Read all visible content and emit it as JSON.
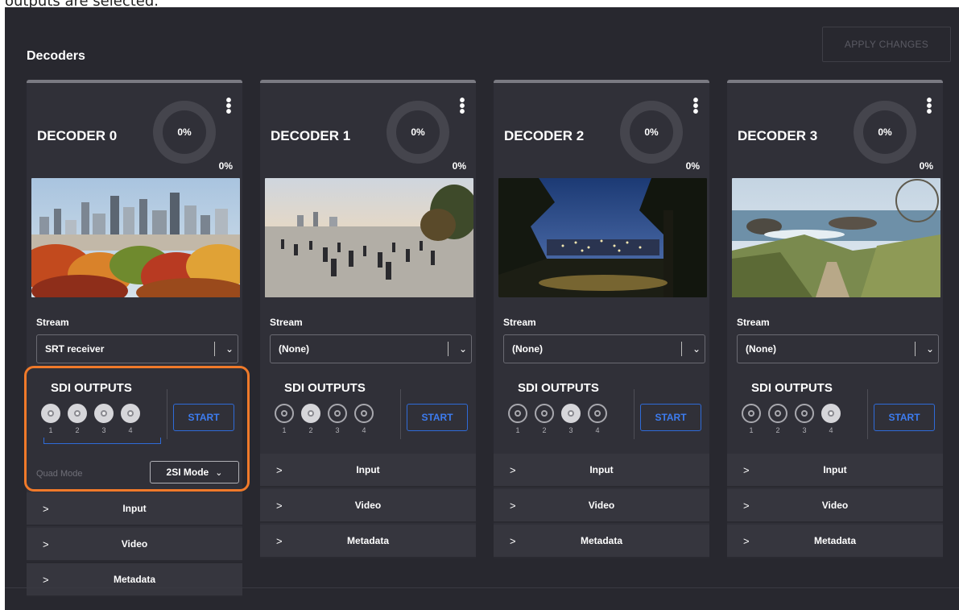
{
  "caption": "outputs are selected.",
  "header": {
    "title": "Decoders",
    "apply_label": "APPLY CHANGES"
  },
  "decoders": [
    {
      "title": "DECODER 0",
      "donut_pct": "0%",
      "pct": "0%",
      "image": "Montreal city skyline with autumn trees",
      "stream_label": "Stream",
      "stream_value": "SRT receiver",
      "sdi_label": "SDI OUTPUTS",
      "sdi_outputs": [
        {
          "num": "1",
          "on": true
        },
        {
          "num": "2",
          "on": true
        },
        {
          "num": "3",
          "on": true
        },
        {
          "num": "4",
          "on": true
        }
      ],
      "start_label": "START",
      "quad_label": "Quad Mode",
      "quad_value": "2SI Mode",
      "sections": [
        "Input",
        "Video",
        "Metadata"
      ]
    },
    {
      "title": "DECODER 1",
      "donut_pct": "0%",
      "pct": "0%",
      "image": "Crowded plaza at dusk overlooking city",
      "stream_label": "Stream",
      "stream_value": "(None)",
      "sdi_label": "SDI OUTPUTS",
      "sdi_outputs": [
        {
          "num": "1",
          "on": false
        },
        {
          "num": "2",
          "on": true
        },
        {
          "num": "3",
          "on": false
        },
        {
          "num": "4",
          "on": false
        }
      ],
      "start_label": "START",
      "sections": [
        "Input",
        "Video",
        "Metadata"
      ]
    },
    {
      "title": "DECODER 2",
      "donut_pct": "0%",
      "pct": "0%",
      "image": "City lights at night seen through trees",
      "stream_label": "Stream",
      "stream_value": "(None)",
      "sdi_label": "SDI OUTPUTS",
      "sdi_outputs": [
        {
          "num": "1",
          "on": false
        },
        {
          "num": "2",
          "on": false
        },
        {
          "num": "3",
          "on": true
        },
        {
          "num": "4",
          "on": false
        }
      ],
      "start_label": "START",
      "sections": [
        "Input",
        "Video",
        "Metadata"
      ]
    },
    {
      "title": "DECODER 3",
      "donut_pct": "0%",
      "pct": "0%",
      "image": "Coastal cliffs with ocean and trail",
      "stream_label": "Stream",
      "stream_value": "(None)",
      "sdi_label": "SDI OUTPUTS",
      "sdi_outputs": [
        {
          "num": "1",
          "on": false
        },
        {
          "num": "2",
          "on": false
        },
        {
          "num": "3",
          "on": false
        },
        {
          "num": "4",
          "on": true
        }
      ],
      "start_label": "START",
      "sections": [
        "Input",
        "Video",
        "Metadata"
      ]
    }
  ],
  "colors": {
    "panel_bg": "#28282f",
    "card_bg": "#303038",
    "accent_blue": "#2f6bd8",
    "highlight_orange": "#f07a2a"
  }
}
